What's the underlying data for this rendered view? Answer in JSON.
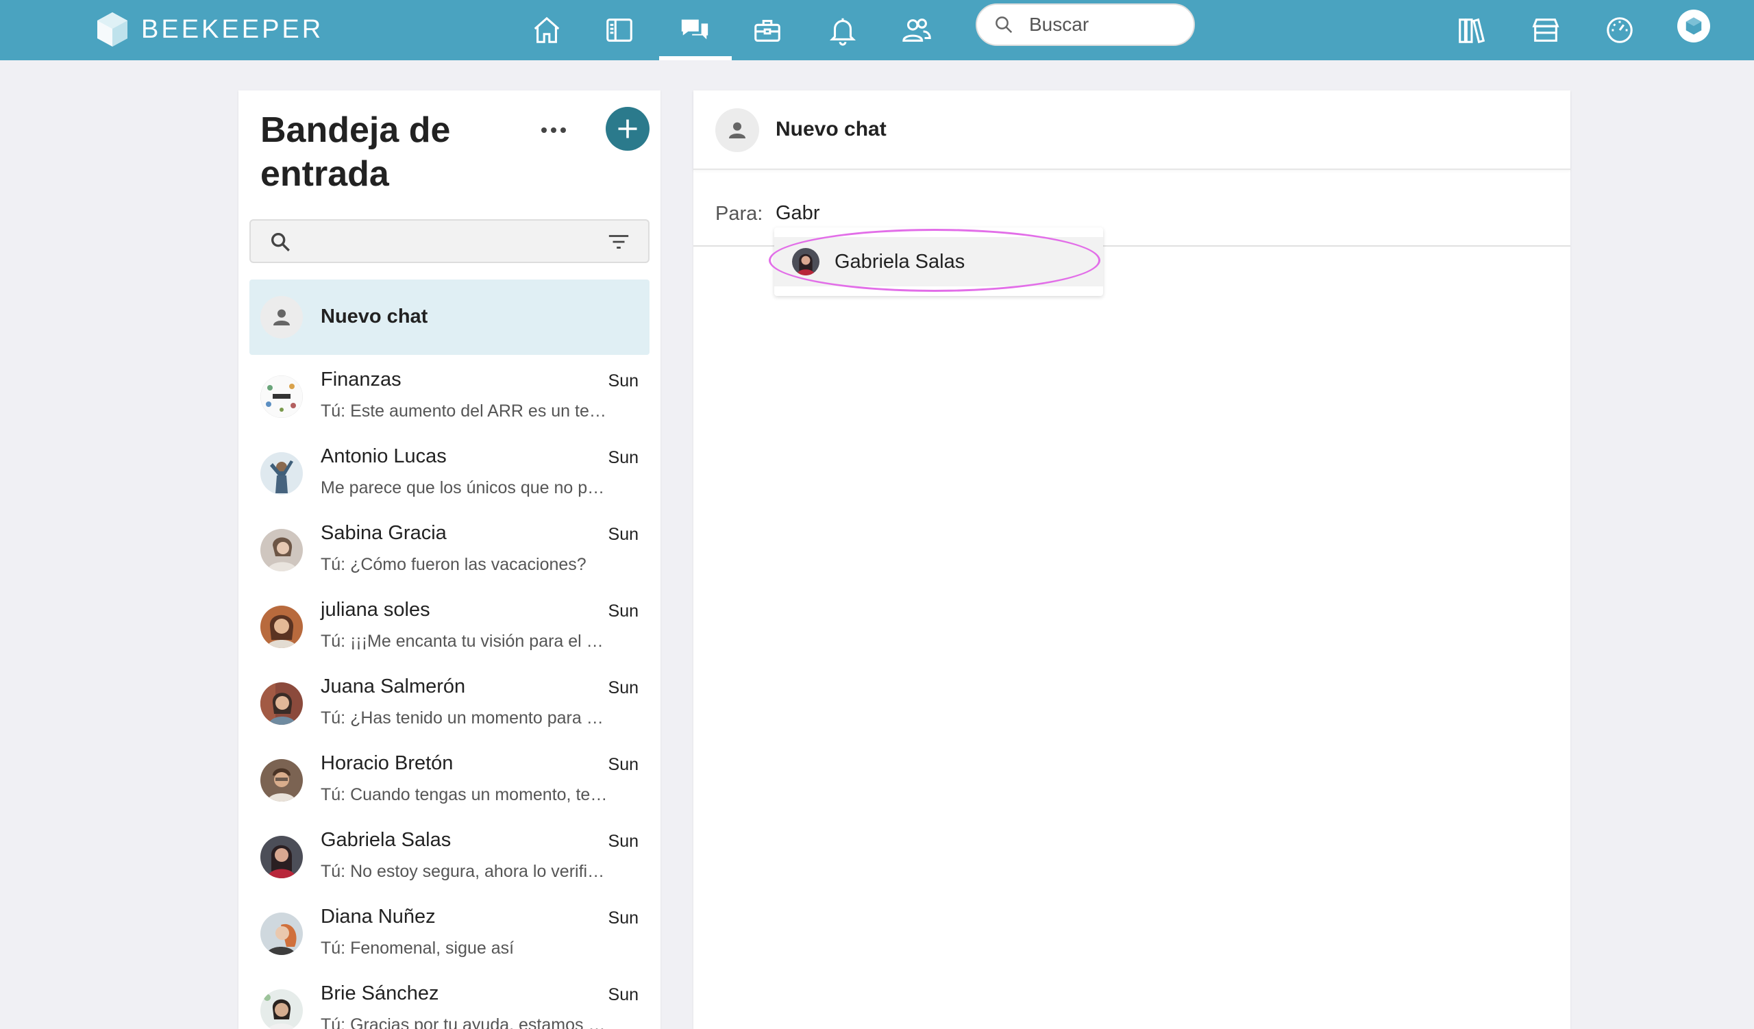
{
  "topbar": {
    "brand": "BEEKEEPER",
    "search_placeholder": "Buscar",
    "nav_icons": [
      "home-icon",
      "newsfeed-icon",
      "chat-icon",
      "toolbox-icon",
      "bell-icon",
      "people-icon"
    ],
    "right_icons": [
      "library-icon",
      "store-icon",
      "dashboard-icon"
    ],
    "brand_color": "#4aa3c0"
  },
  "inbox": {
    "title": "Bandeja de entrada",
    "new_chat_label": "Nuevo chat",
    "chats": [
      {
        "name": "Finanzas",
        "time": "Sun",
        "preview": "Tú: Este aumento del ARR es un testimonio de nuestro trabajo",
        "avatar": "finanzas"
      },
      {
        "name": "Antonio Lucas",
        "time": "Sun",
        "preview": "Me parece que los únicos que no pueden ir son",
        "avatar": "person"
      },
      {
        "name": "Sabina Gracia",
        "time": "Sun",
        "preview": "Tú: ¿Cómo fueron las vacaciones?",
        "avatar": "person"
      },
      {
        "name": "juliana soles",
        "time": "Sun",
        "preview": "Tú: ¡¡¡Me encanta tu visión para el proyecto!!!",
        "avatar": "person"
      },
      {
        "name": "Juana Salmerón",
        "time": "Sun",
        "preview": "Tú: ¿Has tenido un momento para revisar el informe?",
        "avatar": "person"
      },
      {
        "name": "Horacio Bretón",
        "time": "Sun",
        "preview": "Tú: Cuando tengas un momento, te envío los datos",
        "avatar": "person"
      },
      {
        "name": "Gabriela Salas",
        "time": "Sun",
        "preview": "Tú: No estoy segura, ahora lo verifico y te digo",
        "avatar": "person"
      },
      {
        "name": "Diana Nuñez",
        "time": "Sun",
        "preview": "Tú: Fenomenal, sigue así",
        "avatar": "person"
      },
      {
        "name": "Brie Sánchez",
        "time": "Sun",
        "preview": "Tú: Gracias por tu ayuda, estamos en contacto",
        "avatar": "person"
      }
    ]
  },
  "chat": {
    "header_title": "Nuevo chat",
    "to_label": "Para:",
    "to_value": "Gabr",
    "suggestions": [
      {
        "name": "Gabriela Salas"
      }
    ]
  }
}
